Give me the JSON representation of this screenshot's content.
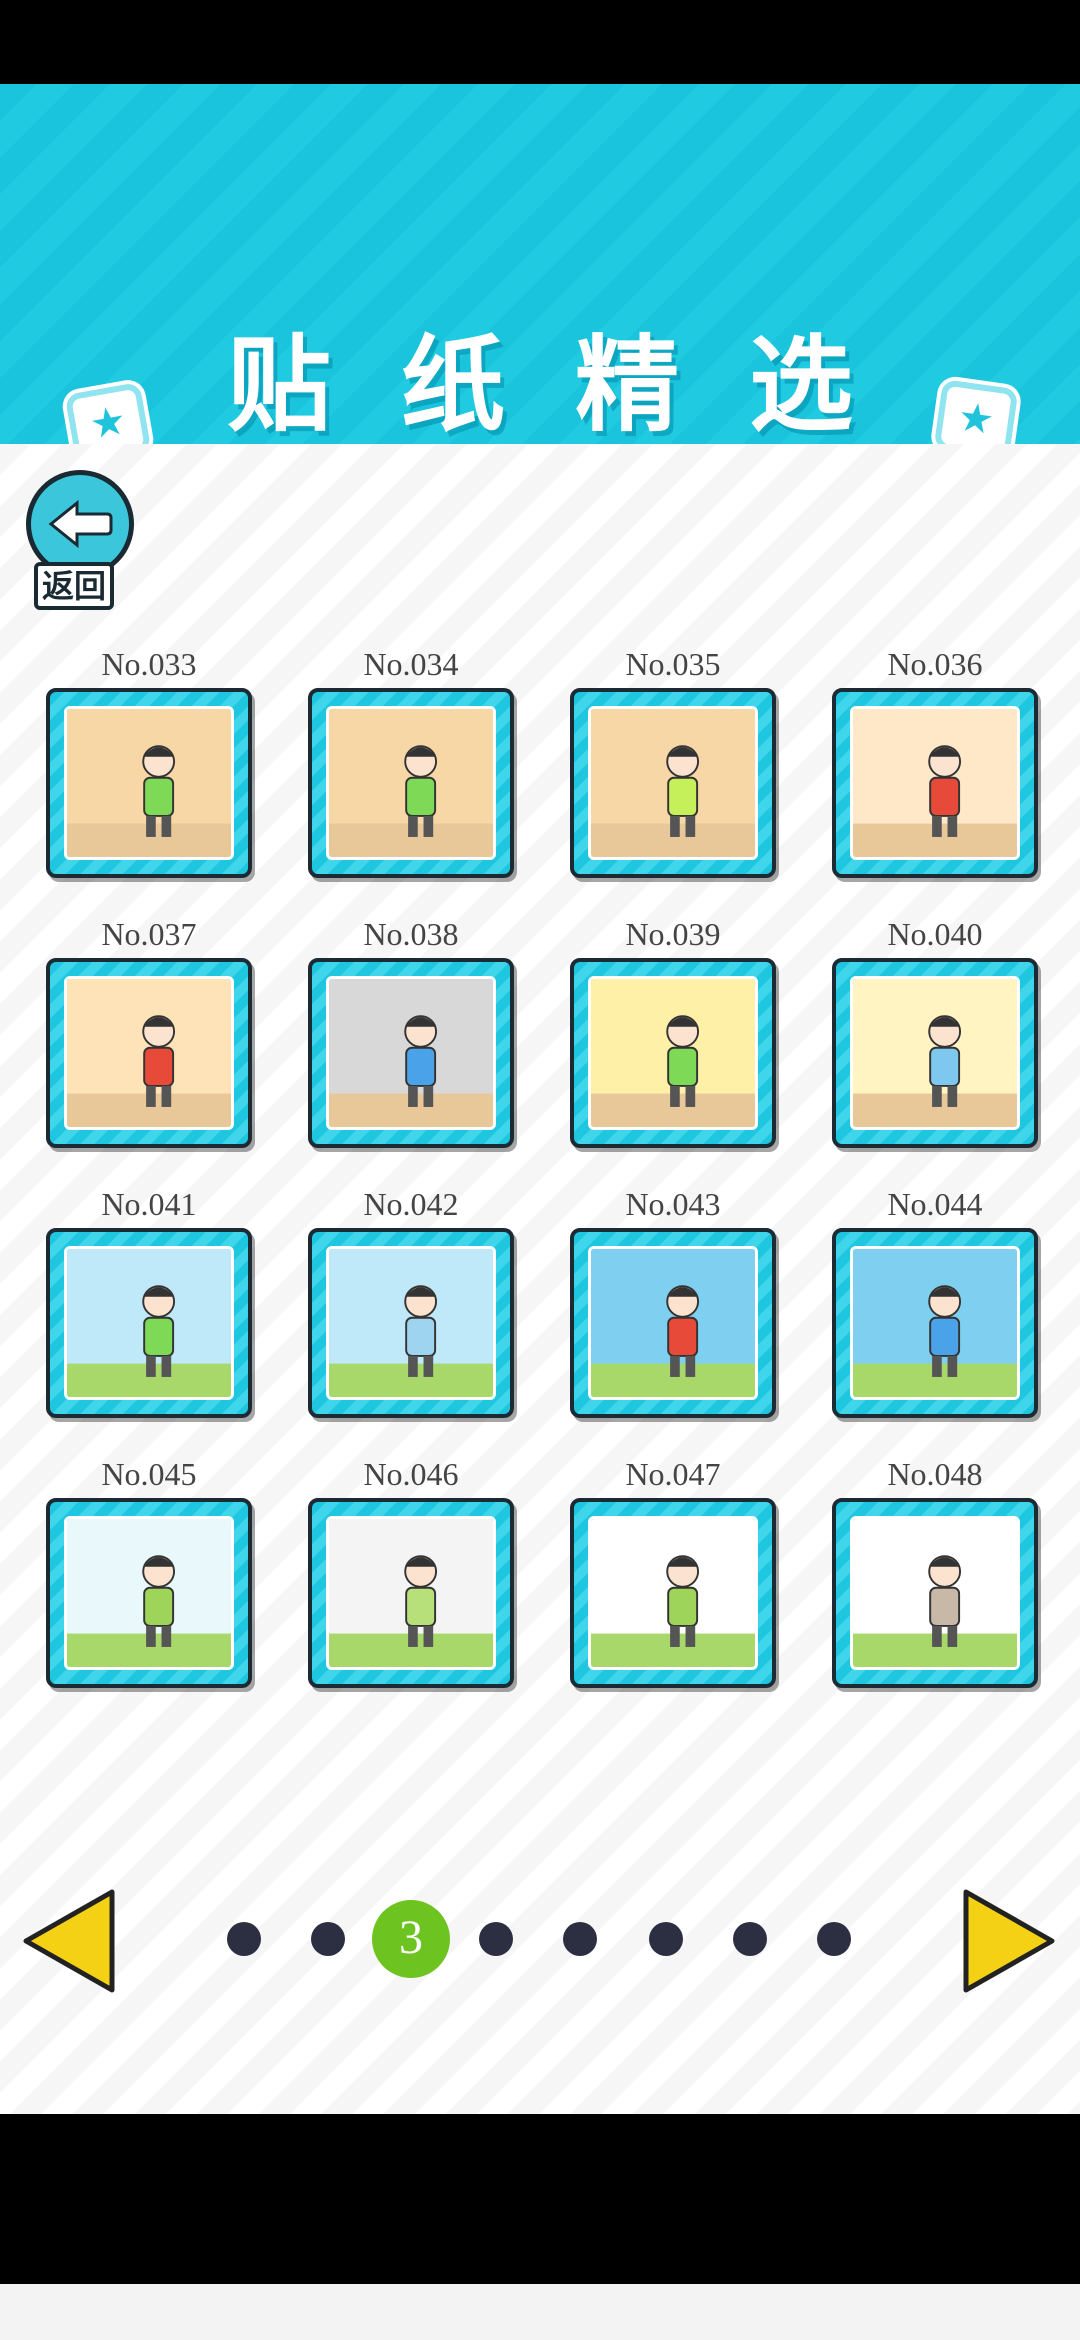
{
  "header": {
    "title": "贴纸精选"
  },
  "back_button": {
    "label": "返回"
  },
  "stickers": [
    {
      "label": "No.033"
    },
    {
      "label": "No.034"
    },
    {
      "label": "No.035"
    },
    {
      "label": "No.036"
    },
    {
      "label": "No.037"
    },
    {
      "label": "No.038"
    },
    {
      "label": "No.039"
    },
    {
      "label": "No.040"
    },
    {
      "label": "No.041"
    },
    {
      "label": "No.042"
    },
    {
      "label": "No.043"
    },
    {
      "label": "No.044"
    },
    {
      "label": "No.045"
    },
    {
      "label": "No.046"
    },
    {
      "label": "No.047"
    },
    {
      "label": "No.048"
    }
  ],
  "pagination": {
    "current_page": "3",
    "total_pages": 8
  },
  "colors": {
    "header_bg": "#19c4dc",
    "frame": "#1ec6e0",
    "arrow": "#f5d116",
    "current_dot": "#6dc420",
    "dot": "#2c2f42"
  },
  "icons": {
    "back": "back-arrow-icon",
    "prev": "triangle-left-icon",
    "next": "triangle-right-icon",
    "badge": "star-icon"
  }
}
